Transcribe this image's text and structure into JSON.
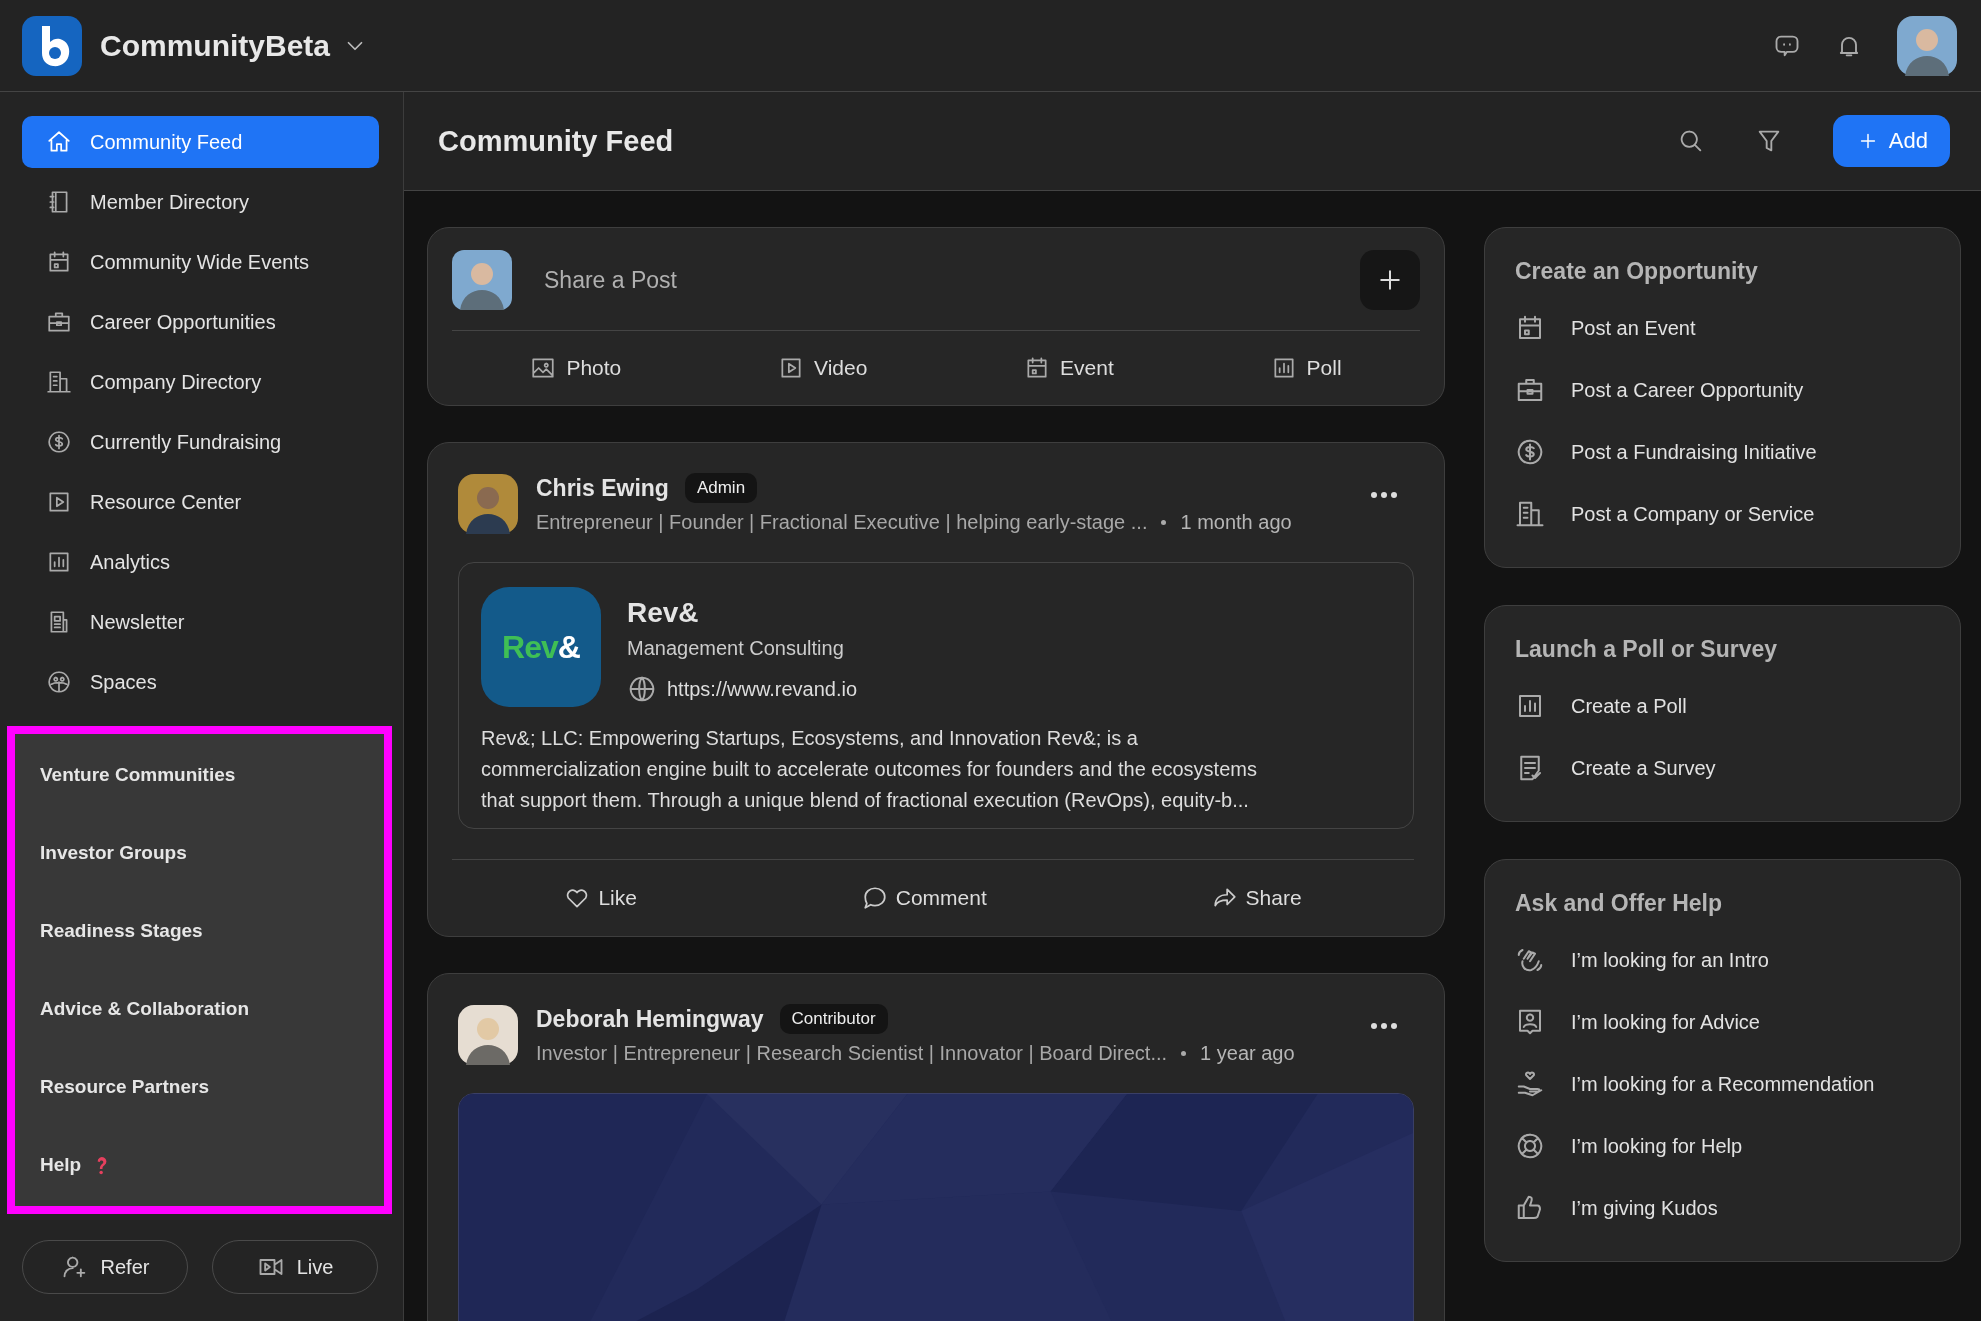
{
  "app": {
    "name": "CommunityBeta"
  },
  "sidebar": {
    "items": [
      {
        "label": "Community Feed",
        "selected": true
      },
      {
        "label": "Member Directory",
        "selected": false
      },
      {
        "label": "Community Wide Events",
        "selected": false
      },
      {
        "label": "Career Opportunities",
        "selected": false
      },
      {
        "label": "Company Directory",
        "selected": false
      },
      {
        "label": "Currently Fundraising",
        "selected": false
      },
      {
        "label": "Resource Center",
        "selected": false
      },
      {
        "label": "Analytics",
        "selected": false
      },
      {
        "label": "Newsletter",
        "selected": false
      },
      {
        "label": "Spaces",
        "selected": false
      }
    ],
    "sections": [
      "Venture Communities",
      "Investor Groups",
      "Readiness Stages",
      "Advice & Collaboration",
      "Resource Partners",
      "Help"
    ],
    "buttons": [
      "Refer",
      "Live"
    ]
  },
  "page_title": "Community Feed",
  "add_button": "Add",
  "composer": {
    "placeholder": "Share a Post",
    "actions": [
      "Photo",
      "Video",
      "Event",
      "Poll"
    ]
  },
  "posts": [
    {
      "author": "Chris Ewing",
      "role": "Admin",
      "headline": "Entrepreneur | Founder | Fractional Executive | helping early-stage ...",
      "time": "1 month ago",
      "link_preview": {
        "logo_parts": [
          {
            "text": "Rev",
            "color": "#3fbf55"
          },
          {
            "text": "&",
            "color": "#ffffff"
          }
        ],
        "title": "Rev&",
        "category": "Management Consulting",
        "url": "https://www.revand.io",
        "description": "Rev&; LLC: Empowering Startups, Ecosystems, and Innovation Rev&; is a commercialization engine built to accelerate outcomes for founders and the ecosystems that support them. Through a unique blend of fractional execution (RevOps), equity-b..."
      },
      "actions": [
        "Like",
        "Comment",
        "Share"
      ]
    },
    {
      "author": "Deborah Hemingway",
      "role": "Contributor",
      "headline": "Investor | Entrepreneur | Research Scientist | Innovator | Board Direct...",
      "time": "1 year ago"
    }
  ],
  "panels": [
    {
      "title": "Create an Opportunity",
      "items": [
        "Post an Event",
        "Post a Career Opportunity",
        "Post a Fundraising Initiative",
        "Post a Company or Service"
      ]
    },
    {
      "title": "Launch a Poll or Survey",
      "items": [
        "Create a Poll",
        "Create a Survey"
      ]
    },
    {
      "title": "Ask and Offer Help",
      "items": [
        "I’m looking for an Intro",
        "I’m looking for Advice",
        "I’m looking for a Recommendation",
        "I’m looking for Help",
        "I’m giving Kudos"
      ]
    }
  ]
}
